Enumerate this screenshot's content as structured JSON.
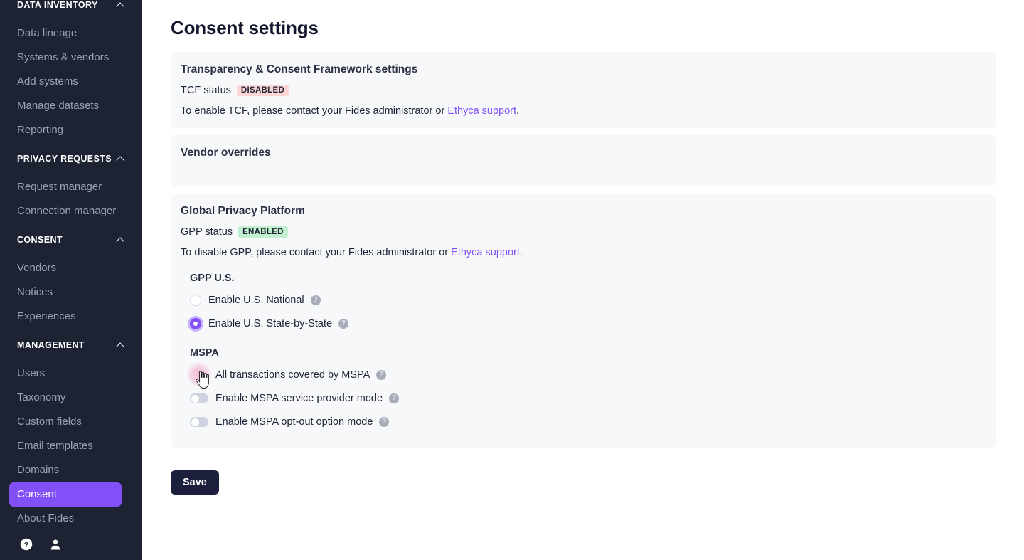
{
  "sidebar": {
    "groups": [
      {
        "label": "DATA INVENTORY",
        "items": [
          {
            "label": "Data lineage"
          },
          {
            "label": "Systems & vendors"
          },
          {
            "label": "Add systems"
          },
          {
            "label": "Manage datasets"
          },
          {
            "label": "Reporting"
          }
        ]
      },
      {
        "label": "PRIVACY REQUESTS",
        "items": [
          {
            "label": "Request manager"
          },
          {
            "label": "Connection manager"
          }
        ]
      },
      {
        "label": "CONSENT",
        "items": [
          {
            "label": "Vendors"
          },
          {
            "label": "Notices"
          },
          {
            "label": "Experiences"
          }
        ]
      },
      {
        "label": "MANAGEMENT",
        "items": [
          {
            "label": "Users"
          },
          {
            "label": "Taxonomy"
          },
          {
            "label": "Custom fields"
          },
          {
            "label": "Email templates"
          },
          {
            "label": "Domains"
          },
          {
            "label": "Consent"
          },
          {
            "label": "About Fides"
          }
        ]
      }
    ],
    "active_item": "Consent",
    "footer": {
      "help_icon": "help-circle-icon",
      "user_icon": "user-account-icon"
    },
    "colors": {
      "background": "#1d2333",
      "active": "#8151f7",
      "item_text": "#9aa3b2"
    }
  },
  "page": {
    "title": "Consent settings"
  },
  "tcf": {
    "card_title": "Transparency & Consent Framework settings",
    "status_label": "TCF status",
    "status_badge": "DISABLED",
    "status_badge_color": "#fbd5d3",
    "help_prefix": "To enable TCF, please contact your Fides administrator or ",
    "help_link": "Ethyca support",
    "help_suffix": "."
  },
  "vendor_overrides": {
    "card_title": "Vendor overrides"
  },
  "gpp": {
    "card_title": "Global Privacy Platform",
    "status_label": "GPP status",
    "status_badge": "ENABLED",
    "status_badge_color": "#c2f0cf",
    "help_prefix": "To disable GPP, please contact your Fides administrator or ",
    "help_link": "Ethyca support",
    "help_suffix": ".",
    "us_section_title": "GPP U.S.",
    "radios": [
      {
        "label": "Enable U.S. National",
        "checked": false,
        "tooltip_icon": "question-mark-icon"
      },
      {
        "label": "Enable U.S. State-by-State",
        "checked": true,
        "tooltip_icon": "question-mark-icon"
      }
    ],
    "mspa_section_title": "MSPA",
    "toggles": [
      {
        "label": "All transactions covered by MSPA",
        "on": false,
        "tooltip_icon": "question-mark-icon"
      },
      {
        "label": "Enable MSPA service provider mode",
        "on": false,
        "tooltip_icon": "question-mark-icon"
      },
      {
        "label": "Enable MSPA opt-out option mode",
        "on": false,
        "tooltip_icon": "question-mark-icon"
      }
    ]
  },
  "actions": {
    "save_label": "Save"
  }
}
